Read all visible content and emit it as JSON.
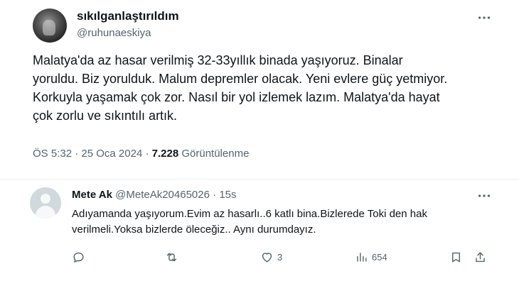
{
  "post": {
    "display_name": "sıkılganlaştırıldım",
    "handle": "@ruhunaeskiya",
    "text": "Malatya'da az hasar verilmiş 32-33yıllık binada yaşıyoruz. Binalar\nyoruldu. Biz yorulduk. Malum depremler olacak. Yeni evlere güç yetmiyor.\nKorkuyla yaşamak çok zor. Nasıl bir yol izlemek lazım. Malatya'da hayat\nçok zorlu ve sıkıntılı artık.",
    "time": "ÖS 5:32",
    "date": "25 Oca 2024",
    "separator": "·",
    "views_count": "7.228",
    "views_label": "Görüntülenme",
    "more_icon": "more-horizontal-icon"
  },
  "reply": {
    "display_name": "Mete Ak",
    "handle": "@MeteAk20465026",
    "separator": "·",
    "time": "15s",
    "text": "Adıyamanda yaşıyorum.Evim az hasarlı..6 katlı bina.Bizlerede Toki den hak\nverilmeli.Yoksa bizlerde öleceğiz.. Aynı durumdayız.",
    "actions": {
      "reply_count": "",
      "repost_count": "",
      "like_count": "3",
      "views_count": "654"
    }
  },
  "colors": {
    "text_primary": "#0f1419",
    "text_secondary": "#536471",
    "divider": "#eff3f4"
  }
}
